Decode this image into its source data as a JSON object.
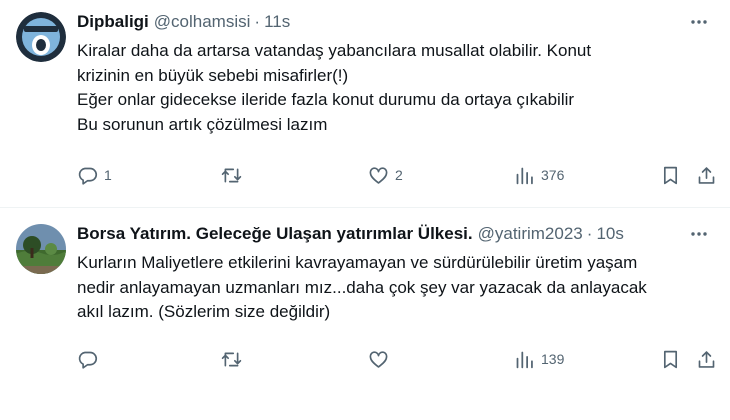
{
  "tweets": [
    {
      "author": "Dipbaligi",
      "handle": "@colhamsisi",
      "time": "11s",
      "lines": [
        "Kiralar daha da artarsa vatandaş yabancılara musallat olabilir. Konut",
        "krizinin en büyük sebebi misafirler(!)",
        "Eğer onlar gidecekse ileride fazla konut durumu da ortaya çıkabilir",
        "Bu sorunun artık çözülmesi lazım"
      ],
      "reply_count": "1",
      "retweet_count": "",
      "like_count": "2",
      "views_count": "376"
    },
    {
      "author": "Borsa Yatırım. Geleceğe Ulaşan yatırımlar Ülkesi.",
      "handle": "@yatirim2023",
      "time": "10s",
      "lines": [
        "Kurların Maliyetlere etkilerini kavrayamayan ve sürdürülebilir üretim yaşam",
        "nedir anlayamayan uzmanları mız...daha çok şey var yazacak da anlayacak",
        "akıl lazım. (Sözlerim size değildir)"
      ],
      "reply_count": "",
      "retweet_count": "",
      "like_count": "",
      "views_count": "139"
    }
  ],
  "icons": {
    "more": "more-horizontal-icon",
    "reply": "reply-icon",
    "retweet": "retweet-icon",
    "like": "heart-icon",
    "views": "views-bar-icon",
    "bookmark": "bookmark-icon",
    "share": "share-icon"
  },
  "colors": {
    "text": "#0f1419",
    "secondary": "#536471",
    "divider": "#eff3f4"
  }
}
